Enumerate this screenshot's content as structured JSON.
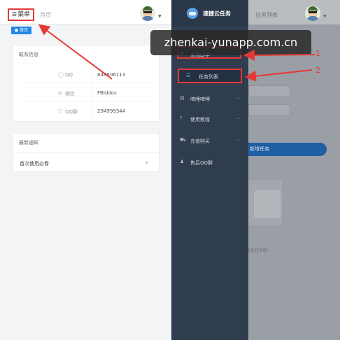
{
  "left": {
    "menu_label": "菜单",
    "breadcrumb": "首页",
    "home_tab": "首页",
    "contact": {
      "title": "联系信息",
      "rows": [
        {
          "icon": "qq-icon",
          "label": "QQ",
          "value": "848806113"
        },
        {
          "icon": "wechat-icon",
          "label": "微信",
          "value": "FBIddos"
        },
        {
          "icon": "group-icon",
          "label": "QQ群",
          "value": "294999344"
        }
      ]
    },
    "notice": {
      "title": "最新通知",
      "item": "首次使用必看",
      "expand": "+"
    }
  },
  "right": {
    "app_title": "速捷云任务",
    "breadcrumb": "任务列表",
    "watermark": "zhenkai-yunapp.com.cn",
    "sidebar": {
      "add_task": "添加助手",
      "task_list": "任务列表",
      "items": [
        {
          "icon": "doc-icon",
          "label": "啤哩啤哩"
        },
        {
          "icon": "question-icon",
          "label": "使用教程"
        },
        {
          "icon": "cart-icon",
          "label": "充值购买"
        },
        {
          "icon": "headset-icon",
          "label": "售后QQ群"
        }
      ]
    },
    "new_task_button": "新增任务",
    "empty_text": "暂无任务哦~",
    "annotations": [
      "1",
      "2"
    ]
  },
  "colors": {
    "accent": "#1e88e5",
    "highlight": "#e53935",
    "sidebar": "#2f3d4e"
  }
}
